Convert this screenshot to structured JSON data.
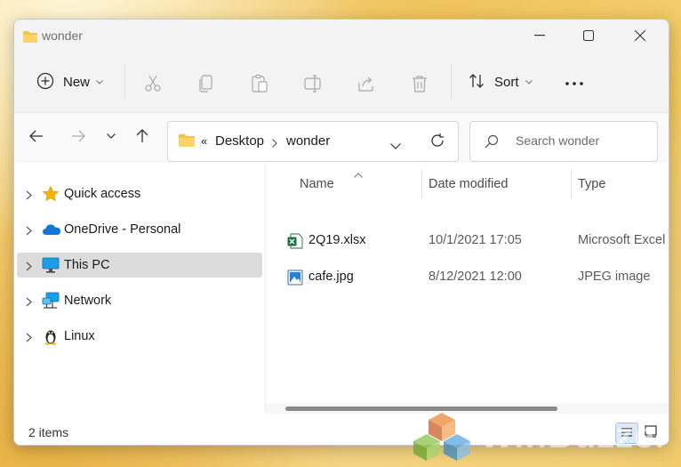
{
  "window": {
    "title": "wonder",
    "controls": [
      "minimize",
      "maximize",
      "close"
    ]
  },
  "toolbar": {
    "new_label": "New",
    "sort_label": "Sort",
    "icons": [
      "cut-icon",
      "copy-icon",
      "paste-icon",
      "rename-icon",
      "share-icon",
      "delete-icon"
    ],
    "more_label": "•••"
  },
  "navigation": {
    "breadcrumb_prefix": "«",
    "breadcrumb": [
      "Desktop",
      "wonder"
    ],
    "search_placeholder": "Search wonder"
  },
  "sidebar": {
    "items": [
      {
        "label": "Quick access",
        "icon": "star-icon",
        "selected": false
      },
      {
        "label": "OneDrive - Personal",
        "icon": "cloud-icon",
        "selected": false
      },
      {
        "label": "This PC",
        "icon": "monitor-icon",
        "selected": true
      },
      {
        "label": "Network",
        "icon": "network-icon",
        "selected": false
      },
      {
        "label": "Linux",
        "icon": "penguin-icon",
        "selected": false
      }
    ]
  },
  "file_list": {
    "columns": [
      "Name",
      "Date modified",
      "Type"
    ],
    "rows": [
      {
        "name": "2Q19.xlsx",
        "date": "10/1/2021 17:05",
        "type": "Microsoft Excel",
        "icon": "excel-file-icon"
      },
      {
        "name": "cafe.jpg",
        "date": "8/12/2021 12:00",
        "type": "JPEG image",
        "icon": "image-file-icon"
      }
    ]
  },
  "status": {
    "item_count": "2 items"
  },
  "watermark": {
    "text": "WinBuzzer"
  },
  "colors": {
    "folder": "#f5c242",
    "accent": "#0067c0",
    "excel": "#1d7044",
    "selection": "#dcdcdc"
  }
}
